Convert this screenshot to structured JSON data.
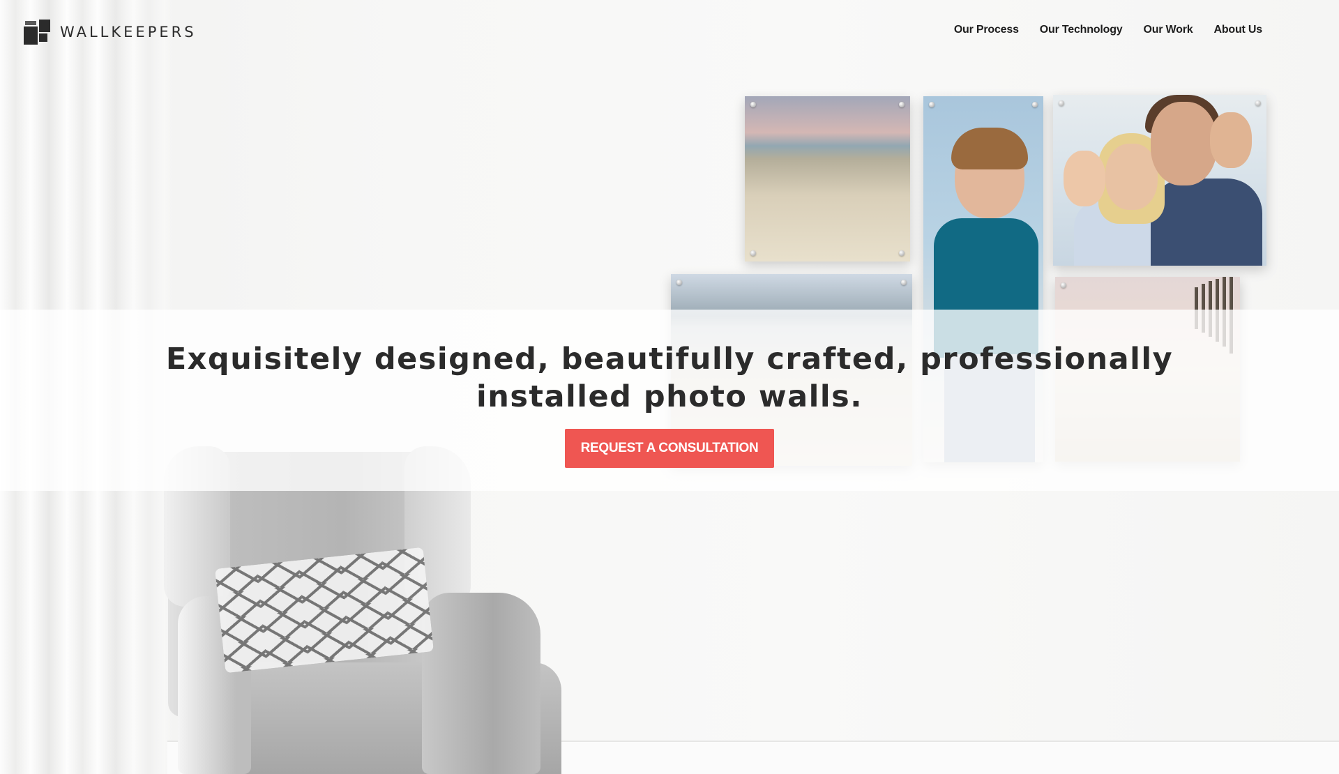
{
  "brand": {
    "name": "WALLKEEPERS",
    "logo_icon": "wallkeepers-logo-icon",
    "text_color": "#2b2b2b"
  },
  "nav": {
    "items": [
      {
        "label": "Our Process"
      },
      {
        "label": "Our Technology"
      },
      {
        "label": "Our Work"
      },
      {
        "label": "About Us"
      }
    ]
  },
  "hero": {
    "headline": "Exquisitely designed, beautifully crafted, professionally installed photo walls.",
    "cta_label": "REQUEST A CONSULTATION",
    "cta_color": "#ef5652"
  }
}
